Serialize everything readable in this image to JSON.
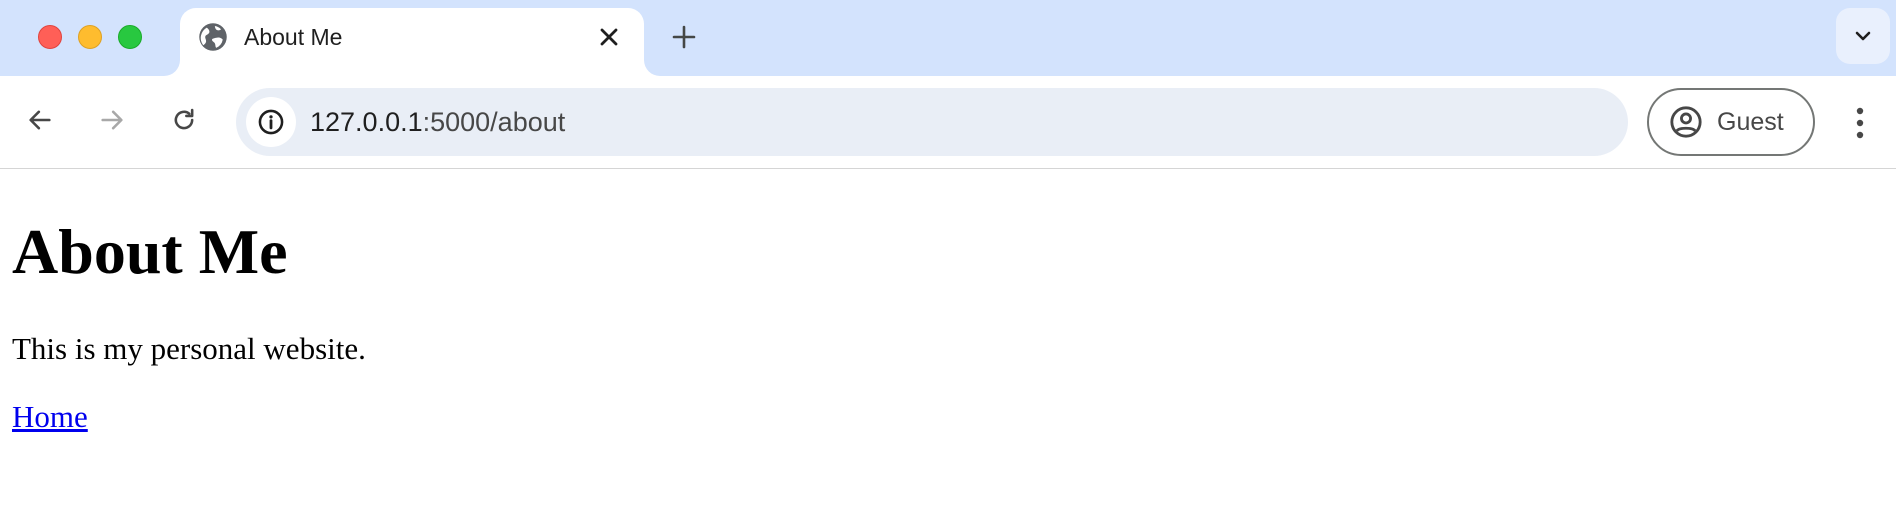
{
  "window": {
    "traffic_lights": [
      "close",
      "minimize",
      "maximize"
    ]
  },
  "tabs": [
    {
      "title": "About Me",
      "favicon": "globe-icon",
      "active": true
    }
  ],
  "tabstrip": {
    "new_tab_icon": "plus-icon",
    "tab_search_icon": "chevron-down-icon"
  },
  "toolbar": {
    "back_icon": "arrow-left-icon",
    "forward_icon": "arrow-right-icon",
    "reload_icon": "reload-icon",
    "site_info_icon": "info-icon",
    "url_host": "127.0.0.1",
    "url_path": ":5000/about",
    "profile_label": "Guest",
    "menu_icon": "kebab-menu-icon"
  },
  "page": {
    "heading": "About Me",
    "description": "This is my personal website.",
    "link_label": "Home"
  },
  "colors": {
    "tabstrip_bg": "#d3e3fd",
    "omnibox_bg": "#e9eef6",
    "link": "#0000ee"
  }
}
